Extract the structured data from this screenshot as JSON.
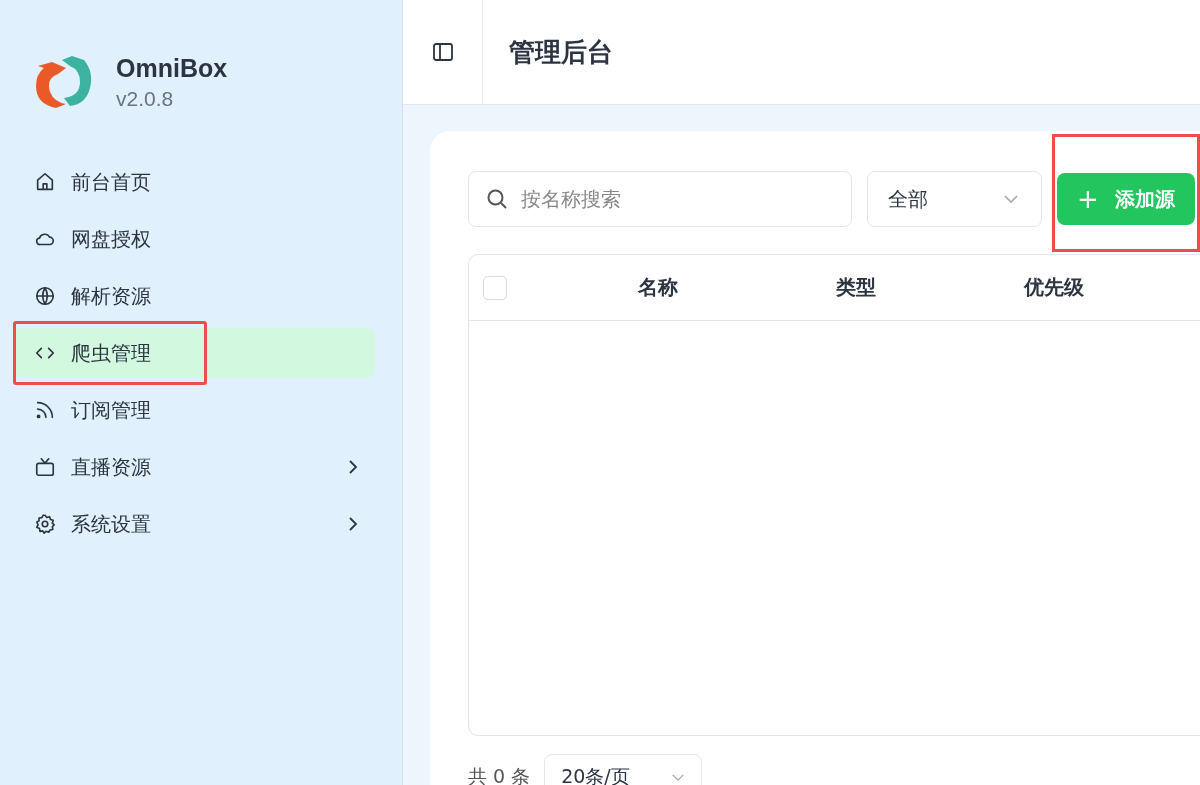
{
  "sidebar": {
    "app_name": "OmniBox",
    "version": "v2.0.8",
    "items": [
      {
        "label": "前台首页",
        "selected": false,
        "highlighted": false,
        "has_submenu": false
      },
      {
        "label": "网盘授权",
        "selected": false,
        "highlighted": false,
        "has_submenu": false
      },
      {
        "label": "解析资源",
        "selected": false,
        "highlighted": false,
        "has_submenu": false
      },
      {
        "label": "爬虫管理",
        "selected": true,
        "highlighted": true,
        "has_submenu": false
      },
      {
        "label": "订阅管理",
        "selected": false,
        "highlighted": false,
        "has_submenu": false
      },
      {
        "label": "直播资源",
        "selected": false,
        "highlighted": false,
        "has_submenu": true
      },
      {
        "label": "系统设置",
        "selected": false,
        "highlighted": false,
        "has_submenu": true
      }
    ]
  },
  "header": {
    "title": "管理后台"
  },
  "toolbar": {
    "search": {
      "placeholder": "按名称搜索"
    },
    "filter": {
      "value": "全部"
    },
    "add_button": {
      "icon": "+",
      "label": "添加源",
      "highlighted": true
    }
  },
  "table": {
    "select_all": {
      "checked": false
    },
    "columns": [
      "名称",
      "类型",
      "优先级"
    ]
  },
  "footer": {
    "total": "共 0 条",
    "page_size": "20条/页"
  }
}
